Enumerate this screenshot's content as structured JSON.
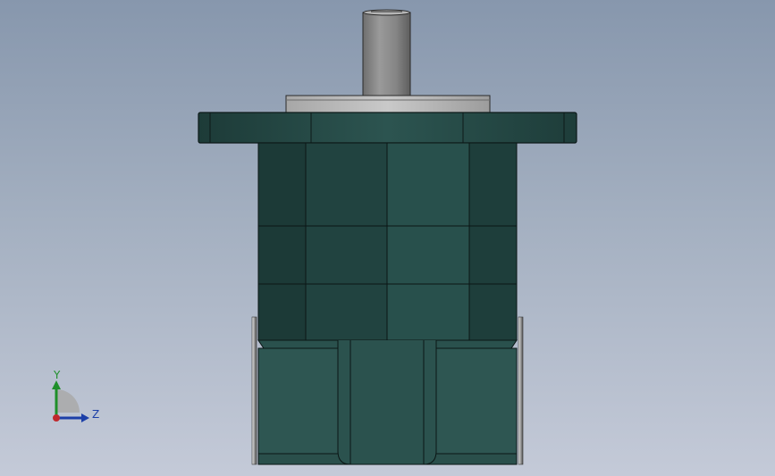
{
  "viewport": {
    "background_top": "#8797ad",
    "background_bottom": "#c4cad8"
  },
  "model": {
    "body_color": "#234743",
    "shaft_color": "#8a8a8a"
  },
  "triad": {
    "y_label": "Y",
    "z_label": "Z",
    "y_color": "#1f8f2a",
    "z_color": "#1c3fa8",
    "origin_color": "#c0282d"
  }
}
